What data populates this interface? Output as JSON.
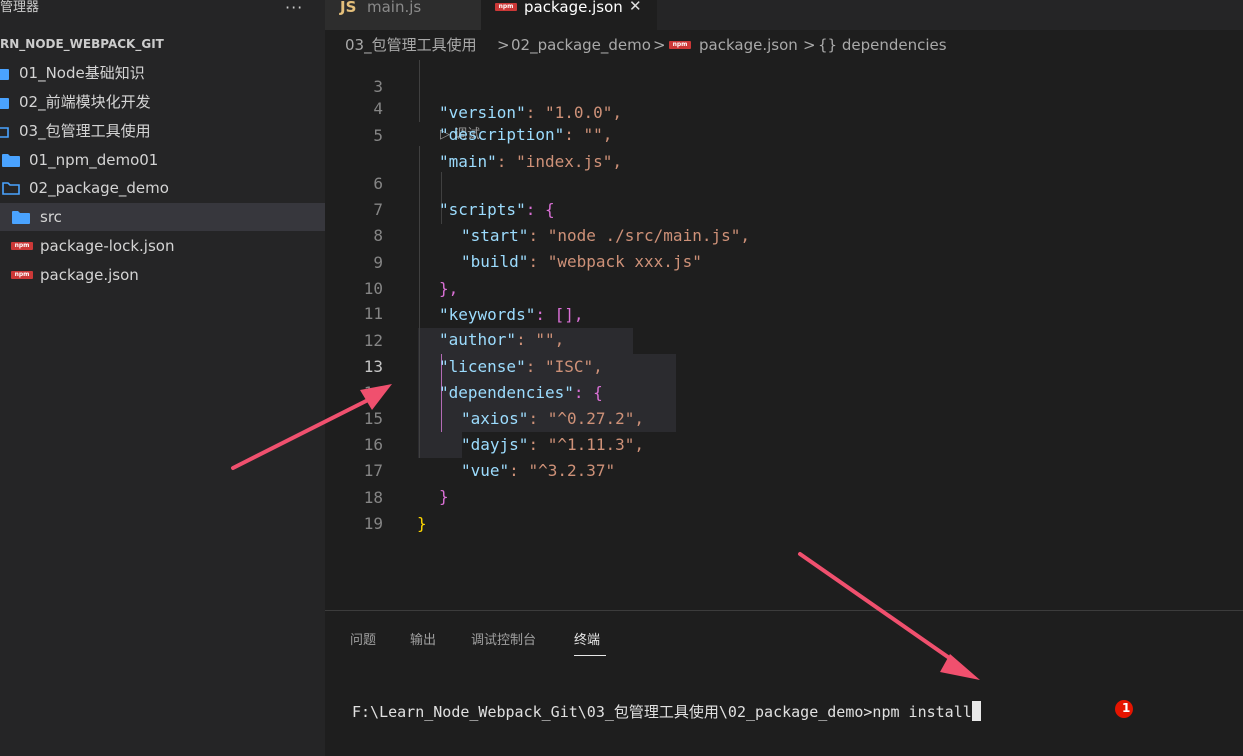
{
  "sidebar": {
    "title": "管理器",
    "more": "···",
    "root": "RN_NODE_WEBPACK_GIT",
    "items": [
      {
        "label": "01_Node基础知识"
      },
      {
        "label": "02_前端模块化开发"
      },
      {
        "label": "03_包管理工具使用"
      },
      {
        "label": "01_npm_demo01"
      },
      {
        "label": "02_package_demo"
      },
      {
        "label": "src"
      },
      {
        "label": "package-lock.json",
        "icon_text": "npm"
      },
      {
        "label": "package.json",
        "icon_text": "npm"
      }
    ]
  },
  "tabs": [
    {
      "label": "main.js",
      "icon_text": "JS"
    },
    {
      "label": "package.json",
      "icon_text": "npm",
      "close": "✕"
    }
  ],
  "breadcrumb": {
    "parts": [
      "03_包管理工具使用",
      "02_package_demo",
      "package.json",
      "{} dependencies"
    ],
    "sep": ">",
    "npm_icon": "npm"
  },
  "editor": {
    "codelens": "▷ 调试",
    "lines": [
      {
        "n": "3",
        "key": "\"version\"",
        "rest": ": \"1.0.0\","
      },
      {
        "n": "4",
        "key": "\"description\"",
        "rest": ": \"\","
      },
      {
        "n": "5",
        "key": "\"main\"",
        "rest": ": \"index.js\","
      },
      {
        "n": "6",
        "key": "\"scripts\"",
        "rest": ": {"
      },
      {
        "n": "7",
        "key": "\"start\"",
        "rest": ": \"node ./src/main.js\","
      },
      {
        "n": "8",
        "key": "\"build\"",
        "rest": ": \"webpack xxx.js\""
      },
      {
        "n": "9",
        "key": "",
        "rest": "},"
      },
      {
        "n": "10",
        "key": "\"keywords\"",
        "rest": ": [],"
      },
      {
        "n": "11",
        "key": "\"author\"",
        "rest": ": \"\","
      },
      {
        "n": "12",
        "key": "\"license\"",
        "rest": ": \"ISC\","
      },
      {
        "n": "13",
        "key": "\"dependencies\"",
        "rest": ": {"
      },
      {
        "n": "14",
        "key": "\"axios\"",
        "rest": ": \"^0.27.2\","
      },
      {
        "n": "15",
        "key": "\"dayjs\"",
        "rest": ": \"^1.11.3\","
      },
      {
        "n": "16",
        "key": "\"vue\"",
        "rest": ": \"^3.2.37\""
      },
      {
        "n": "17",
        "key": "",
        "rest": "}"
      },
      {
        "n": "18",
        "key": "",
        "rest": "}"
      },
      {
        "n": "19",
        "key": "",
        "rest": ""
      }
    ]
  },
  "panel": {
    "tabs": [
      "问题",
      "输出",
      "调试控制台",
      "终端"
    ],
    "active_tab": "终端",
    "terminal_prompt": "F:\\Learn_Node_Webpack_Git\\03_包管理工具使用\\02_package_demo>",
    "terminal_command": "npm install",
    "error_count": "1"
  },
  "colors": {
    "accent_folder": "#4aa3ff",
    "npm_red": "#cb3837",
    "annotation_arrow": "#f0506e"
  }
}
